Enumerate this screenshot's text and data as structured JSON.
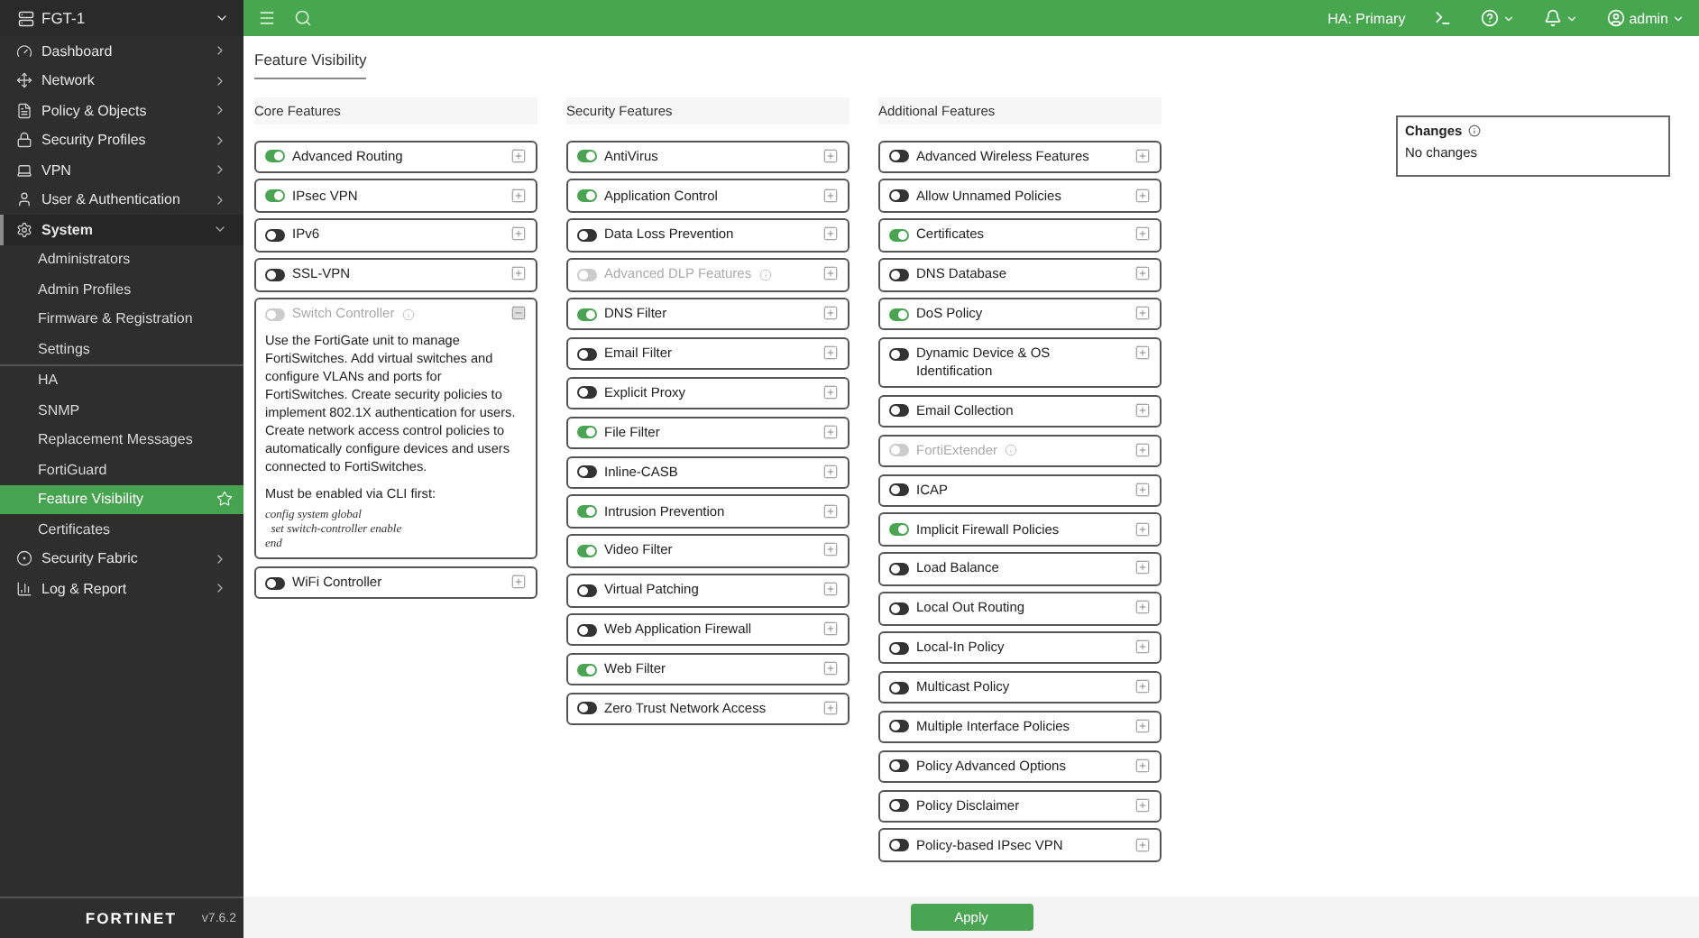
{
  "device": {
    "name": "FGT-1"
  },
  "sidebar": {
    "items": [
      {
        "label": "Dashboard",
        "expanded": false
      },
      {
        "label": "Network",
        "expanded": false
      },
      {
        "label": "Policy & Objects",
        "expanded": false
      },
      {
        "label": "Security Profiles",
        "expanded": false
      },
      {
        "label": "VPN",
        "expanded": false
      },
      {
        "label": "User & Authentication",
        "expanded": false
      },
      {
        "label": "System",
        "expanded": true,
        "groups": [
          [
            {
              "label": "Administrators",
              "selected": false
            },
            {
              "label": "Admin Profiles",
              "selected": false
            },
            {
              "label": "Firmware & Registration",
              "selected": false
            },
            {
              "label": "Settings",
              "selected": false
            }
          ],
          [
            {
              "label": "HA",
              "selected": false
            },
            {
              "label": "SNMP",
              "selected": false
            },
            {
              "label": "Replacement Messages",
              "selected": false
            },
            {
              "label": "FortiGuard",
              "selected": false
            },
            {
              "label": "Feature Visibility",
              "selected": true
            },
            {
              "label": "Certificates",
              "selected": false
            }
          ]
        ]
      },
      {
        "label": "Security Fabric",
        "expanded": false
      },
      {
        "label": "Log & Report",
        "expanded": false
      }
    ],
    "logo": "FORTINET",
    "version": "v7.6.2"
  },
  "topbar": {
    "ha_status": "HA: Primary",
    "user": "admin"
  },
  "page": {
    "title": "Feature Visibility",
    "columns": [
      {
        "heading": "Core Features",
        "features": [
          {
            "label": "Advanced Routing",
            "on": true,
            "disabled": false,
            "expanded": false
          },
          {
            "label": "IPsec VPN",
            "on": true,
            "disabled": false,
            "expanded": false
          },
          {
            "label": "IPv6",
            "on": false,
            "disabled": false,
            "expanded": false
          },
          {
            "label": "SSL-VPN",
            "on": false,
            "disabled": false,
            "expanded": false
          },
          {
            "label": "Switch Controller",
            "on": false,
            "disabled": true,
            "expanded": true,
            "description": "Use the FortiGate unit to manage FortiSwitches. Add virtual switches and configure VLANs and ports for FortiSwitches. Create security policies to implement 802.1X authentication for users. Create network access control policies to automatically configure devices and users connected to FortiSwitches.",
            "note": "Must be enabled via CLI first:",
            "code": [
              "config system global",
              "  set switch-controller enable",
              "end"
            ]
          },
          {
            "label": "WiFi Controller",
            "on": false,
            "disabled": false,
            "expanded": false
          }
        ]
      },
      {
        "heading": "Security Features",
        "features": [
          {
            "label": "AntiVirus",
            "on": true,
            "disabled": false,
            "expanded": false
          },
          {
            "label": "Application Control",
            "on": true,
            "disabled": false,
            "expanded": false
          },
          {
            "label": "Data Loss Prevention",
            "on": false,
            "disabled": false,
            "expanded": false
          },
          {
            "label": "Advanced DLP Features",
            "on": false,
            "disabled": true,
            "expanded": false
          },
          {
            "label": "DNS Filter",
            "on": true,
            "disabled": false,
            "expanded": false
          },
          {
            "label": "Email Filter",
            "on": false,
            "disabled": false,
            "expanded": false
          },
          {
            "label": "Explicit Proxy",
            "on": false,
            "disabled": false,
            "expanded": false
          },
          {
            "label": "File Filter",
            "on": true,
            "disabled": false,
            "expanded": false
          },
          {
            "label": "Inline-CASB",
            "on": false,
            "disabled": false,
            "expanded": false
          },
          {
            "label": "Intrusion Prevention",
            "on": true,
            "disabled": false,
            "expanded": false
          },
          {
            "label": "Video Filter",
            "on": true,
            "disabled": false,
            "expanded": false
          },
          {
            "label": "Virtual Patching",
            "on": false,
            "disabled": false,
            "expanded": false
          },
          {
            "label": "Web Application Firewall",
            "on": false,
            "disabled": false,
            "expanded": false
          },
          {
            "label": "Web Filter",
            "on": true,
            "disabled": false,
            "expanded": false
          },
          {
            "label": "Zero Trust Network Access",
            "on": false,
            "disabled": false,
            "expanded": false
          }
        ]
      },
      {
        "heading": "Additional Features",
        "features": [
          {
            "label": "Advanced Wireless Features",
            "on": false,
            "disabled": false,
            "expanded": false
          },
          {
            "label": "Allow Unnamed Policies",
            "on": false,
            "disabled": false,
            "expanded": false
          },
          {
            "label": "Certificates",
            "on": true,
            "disabled": false,
            "expanded": false
          },
          {
            "label": "DNS Database",
            "on": false,
            "disabled": false,
            "expanded": false
          },
          {
            "label": "DoS Policy",
            "on": true,
            "disabled": false,
            "expanded": false
          },
          {
            "label": "Dynamic Device & OS Identification",
            "on": false,
            "disabled": false,
            "expanded": false
          },
          {
            "label": "Email Collection",
            "on": false,
            "disabled": false,
            "expanded": false
          },
          {
            "label": "FortiExtender",
            "on": false,
            "disabled": true,
            "expanded": false
          },
          {
            "label": "ICAP",
            "on": false,
            "disabled": false,
            "expanded": false
          },
          {
            "label": "Implicit Firewall Policies",
            "on": true,
            "disabled": false,
            "expanded": false
          },
          {
            "label": "Load Balance",
            "on": false,
            "disabled": false,
            "expanded": false
          },
          {
            "label": "Local Out Routing",
            "on": false,
            "disabled": false,
            "expanded": false
          },
          {
            "label": "Local-In Policy",
            "on": false,
            "disabled": false,
            "expanded": false
          },
          {
            "label": "Multicast Policy",
            "on": false,
            "disabled": false,
            "expanded": false
          },
          {
            "label": "Multiple Interface Policies",
            "on": false,
            "disabled": false,
            "expanded": false
          },
          {
            "label": "Policy Advanced Options",
            "on": false,
            "disabled": false,
            "expanded": false
          },
          {
            "label": "Policy Disclaimer",
            "on": false,
            "disabled": false,
            "expanded": false
          },
          {
            "label": "Policy-based IPsec VPN",
            "on": false,
            "disabled": false,
            "expanded": false
          }
        ]
      }
    ]
  },
  "changes": {
    "title": "Changes",
    "text": "No changes"
  },
  "apply_button": "Apply"
}
